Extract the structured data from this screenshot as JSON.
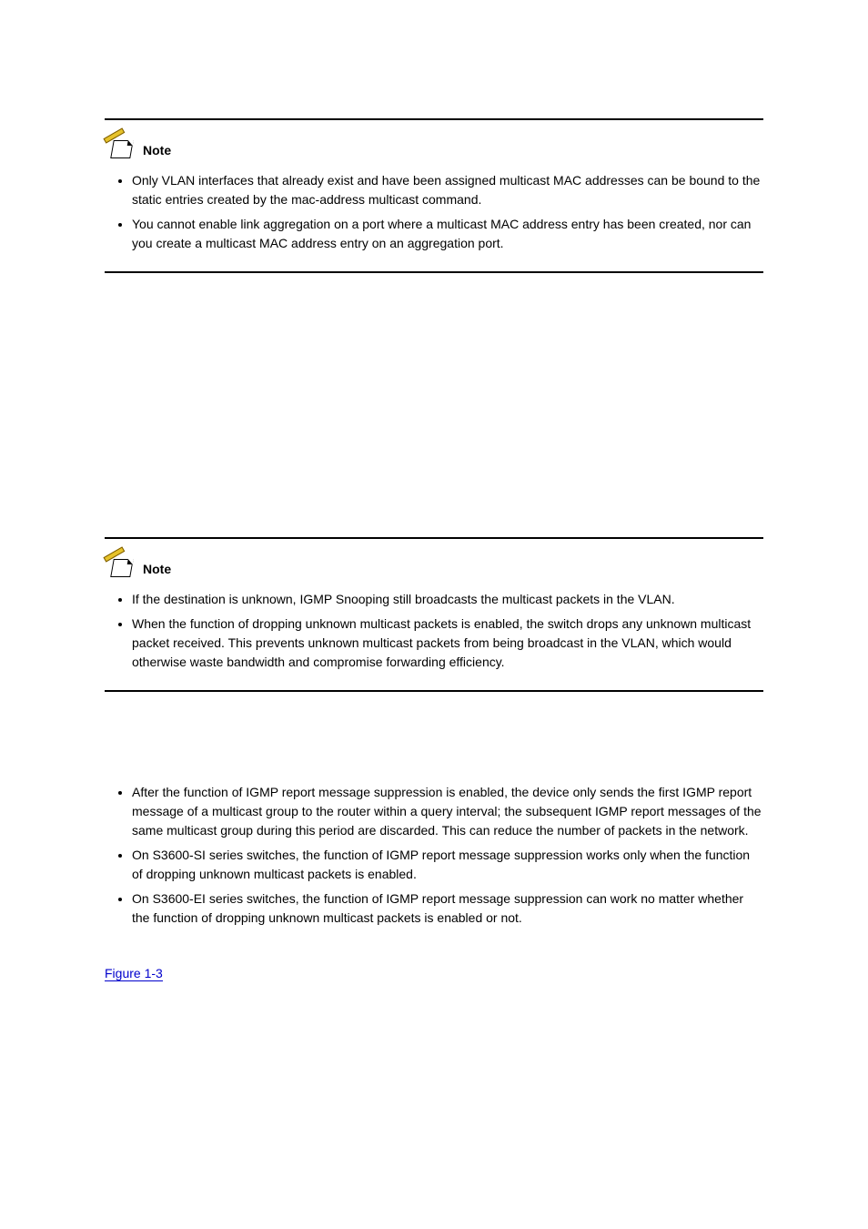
{
  "note_label": "Note",
  "block1": {
    "items": [
      "Only VLAN interfaces that already exist and have been assigned multicast MAC addresses can be bound to the static entries created by the mac-address multicast command.",
      "You cannot enable link aggregation on a port where a multicast MAC address entry has been created, nor can you create a multicast MAC address entry on an aggregation port."
    ]
  },
  "block2": {
    "items": [
      "If the destination is unknown, IGMP Snooping still broadcasts the multicast packets in the VLAN.",
      "When the function of dropping unknown multicast packets is enabled, the switch drops any unknown multicast packet received. This prevents unknown multicast packets from being broadcast in the VLAN, which would otherwise waste bandwidth and compromise forwarding efficiency."
    ]
  },
  "middle": {
    "items": [
      "After the function of IGMP report message suppression is enabled, the device only sends the first IGMP report message of a multicast group to the router within a query interval; the subsequent IGMP report messages of the same multicast group during this period are discarded. This can reduce the number of packets in the network.",
      "On S3600-SI series switches, the function of IGMP report message suppression works only when the function of dropping unknown multicast packets is enabled.",
      "On S3600-EI series switches, the function of IGMP report message suppression can work no matter whether the function of dropping unknown multicast packets is enabled or not."
    ]
  },
  "figref": "Figure 1-3"
}
